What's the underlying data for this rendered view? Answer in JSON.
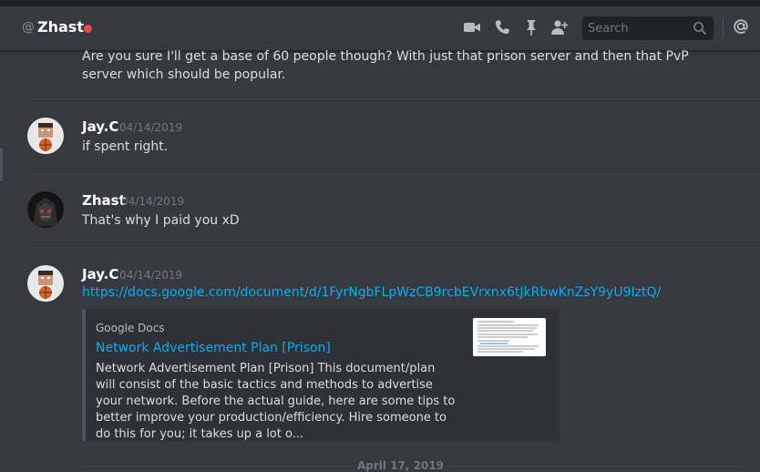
{
  "header": {
    "at_symbol": "@",
    "username": "Zhast",
    "status_color": "#f04747",
    "icons": [
      "video-call-icon",
      "voice-call-icon",
      "pin-icon",
      "add-friend-icon",
      "mention-icon"
    ],
    "search_placeholder": "Search"
  },
  "messages": [
    {
      "type": "continuation",
      "text": "Are you sure I'll get a base of 60 people though? With just that prison server and then that PvP server which should be popular."
    },
    {
      "type": "group",
      "author": "Jay.C",
      "timestamp": "04/14/2019",
      "text": "if spent right."
    },
    {
      "type": "group",
      "author": "Zhast",
      "timestamp": "04/14/2019",
      "text": "That's why I paid you xD"
    },
    {
      "type": "group",
      "author": "Jay.C",
      "timestamp": "04/14/2019",
      "link": "https://docs.google.com/document/d/1FyrNgbFLpWzCB9rcbEVrxnx6tJkRbwKnZsY9yU9IztQ/",
      "embed": {
        "provider": "Google Docs",
        "title": "Network Advertisement Plan [Prison]",
        "description": "Network Advertisement Plan [Prison] This document/plan will consist of the basic tactics and methods to advertise your network. Before the actual guide, here are some tips to better improve your production/efficiency. Hire someone to do this for you; it takes up a lot o..."
      }
    }
  ],
  "date_divider": "April 17, 2019",
  "colors": {
    "background": "#36393f",
    "link": "#00b0f4",
    "embed_bg": "#2f3136",
    "embed_border": "#4f545c"
  }
}
